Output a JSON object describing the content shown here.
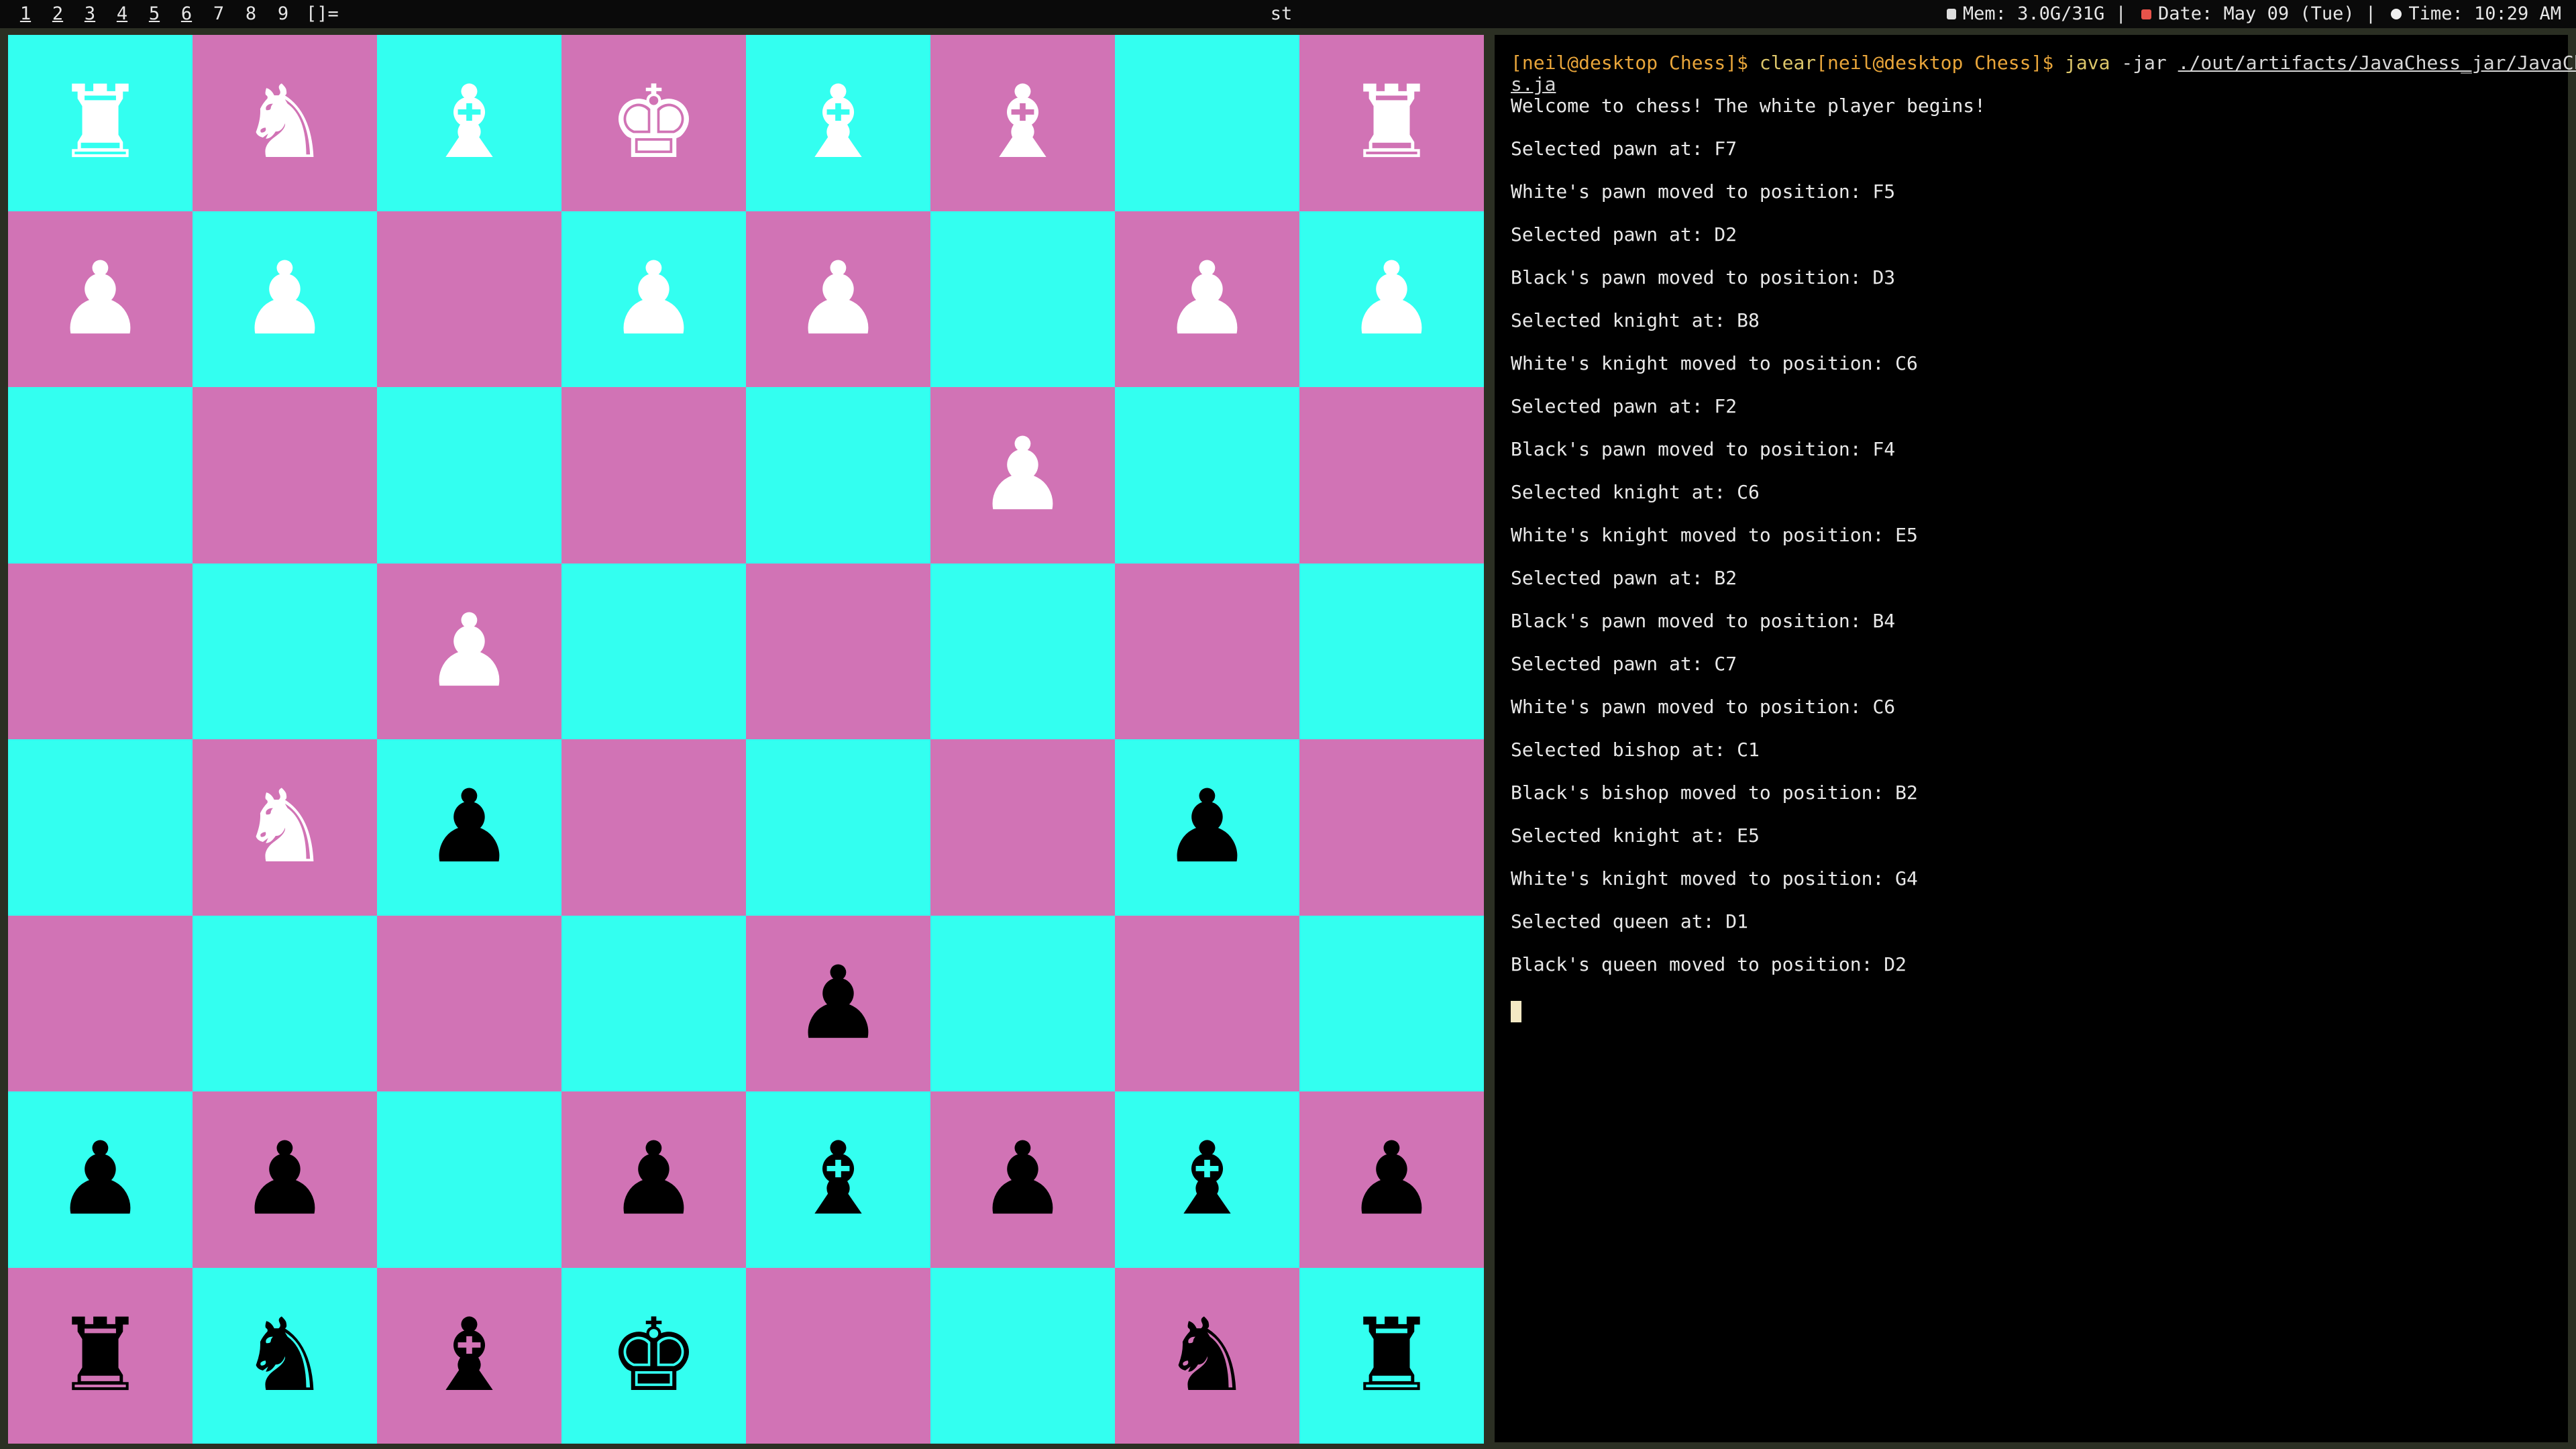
{
  "topbar": {
    "tags": [
      "1",
      "2",
      "3",
      "4",
      "5",
      "6",
      "7",
      "8",
      "9"
    ],
    "layout_symbol": "[]=",
    "window_title": "st",
    "mem": "Mem: 3.0G/31G",
    "date": "Date: May 09 (Tue)",
    "time": "Time: 10:29 AM",
    "separator": "|"
  },
  "board": {
    "colors": {
      "light": "#33fff0",
      "dark": "#d173b5"
    },
    "rows": [
      [
        {
          "c": "w",
          "p": "rook"
        },
        {
          "c": "w",
          "p": "knight"
        },
        {
          "c": "w",
          "p": "bishop"
        },
        {
          "c": "w",
          "p": "king"
        },
        {
          "c": "w",
          "p": "bishop"
        },
        {
          "c": "w",
          "p": "bishop"
        },
        null,
        {
          "c": "w",
          "p": "rook"
        }
      ],
      [
        {
          "c": "w",
          "p": "pawn"
        },
        {
          "c": "w",
          "p": "pawn"
        },
        null,
        {
          "c": "w",
          "p": "pawn"
        },
        {
          "c": "w",
          "p": "pawn"
        },
        null,
        {
          "c": "w",
          "p": "pawn"
        },
        {
          "c": "w",
          "p": "pawn"
        }
      ],
      [
        null,
        null,
        null,
        null,
        null,
        {
          "c": "w",
          "p": "pawn"
        },
        null,
        null
      ],
      [
        null,
        null,
        {
          "c": "w",
          "p": "pawn"
        },
        null,
        null,
        null,
        null,
        null
      ],
      [
        null,
        {
          "c": "w",
          "p": "knight"
        },
        {
          "c": "b",
          "p": "pawn"
        },
        null,
        null,
        null,
        {
          "c": "b",
          "p": "pawn"
        },
        null
      ],
      [
        null,
        null,
        null,
        null,
        {
          "c": "b",
          "p": "pawn"
        },
        null,
        null,
        null
      ],
      [
        {
          "c": "b",
          "p": "pawn"
        },
        {
          "c": "b",
          "p": "pawn"
        },
        null,
        {
          "c": "b",
          "p": "pawn"
        },
        {
          "c": "b",
          "p": "bishop"
        },
        {
          "c": "b",
          "p": "pawn"
        },
        {
          "c": "b",
          "p": "bishop"
        },
        {
          "c": "b",
          "p": "pawn"
        }
      ],
      [
        {
          "c": "b",
          "p": "rook"
        },
        {
          "c": "b",
          "p": "knight"
        },
        {
          "c": "b",
          "p": "bishop"
        },
        {
          "c": "b",
          "p": "king"
        },
        null,
        null,
        {
          "c": "b",
          "p": "knight"
        },
        {
          "c": "b",
          "p": "rook"
        }
      ]
    ]
  },
  "terminal": {
    "prompt1": "[neil@desktop Chess]$ ",
    "cmd1": "clear",
    "prompt2": "[neil@desktop Chess]$ ",
    "cmd2": "java",
    "arg2": " -jar ",
    "path_line1": "./out/artifacts/JavaChess_jar/JavaChes",
    "path_line2": "s.ja",
    "output": [
      "Welcome to chess! The white player begins!",
      "Selected pawn at: F7",
      "White's pawn moved to position: F5",
      "Selected pawn at: D2",
      "Black's pawn moved to position: D3",
      "Selected knight at: B8",
      "White's knight moved to position: C6",
      "Selected pawn at: F2",
      "Black's pawn moved to position: F4",
      "Selected knight at: C6",
      "White's knight moved to position: E5",
      "Selected pawn at: B2",
      "Black's pawn moved to position: B4",
      "Selected pawn at: C7",
      "White's pawn moved to position: C6",
      "Selected bishop at: C1",
      "Black's bishop moved to position: B2",
      "Selected knight at: E5",
      "White's knight moved to position: G4",
      "Selected queen at: D1",
      "Black's queen moved to position: D2"
    ]
  }
}
